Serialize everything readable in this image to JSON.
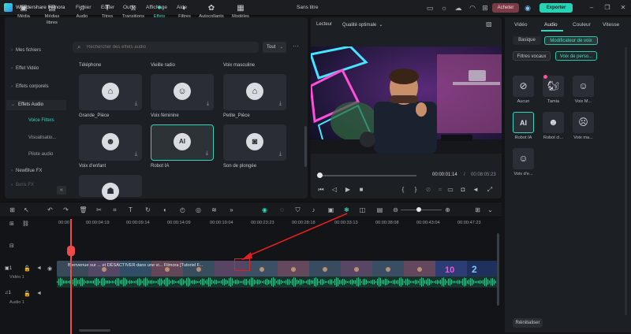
{
  "titlebar": {
    "app_name": "Wondershare Filmora",
    "menu": [
      "Fichier",
      "Editer",
      "Outils",
      "Affichage",
      "Aide"
    ],
    "doc_title": "Sans titre",
    "acheter": "Acheter",
    "exporter": "Exporter"
  },
  "toolbar": {
    "tools": [
      {
        "label": "Média",
        "icon": "media-icon"
      },
      {
        "label": "Médias libres",
        "icon": "stock-media-icon"
      },
      {
        "label": "Audio",
        "icon": "music-icon"
      },
      {
        "label": "Titres",
        "icon": "text-icon"
      },
      {
        "label": "Transitions",
        "icon": "transition-icon"
      },
      {
        "label": "Effets",
        "icon": "effects-icon"
      },
      {
        "label": "Filtres",
        "icon": "filter-icon"
      },
      {
        "label": "Autocollants",
        "icon": "sticker-icon"
      },
      {
        "label": "Modèles",
        "icon": "template-icon"
      }
    ],
    "active": "Effets"
  },
  "sidebar": {
    "items": [
      {
        "label": "Mes fichiers",
        "type": "top"
      },
      {
        "label": "Effet Vidéo",
        "type": "top"
      },
      {
        "label": "Effets corporels",
        "type": "top"
      },
      {
        "label": "Effets Audio",
        "type": "head"
      },
      {
        "label": "Voice Filters",
        "type": "sub-active"
      },
      {
        "label": "Visualisatio...",
        "type": "sub"
      },
      {
        "label": "Pilote audio",
        "type": "sub"
      },
      {
        "label": "NewBlue FX",
        "type": "top"
      },
      {
        "label": "Boris FX",
        "type": "top"
      }
    ]
  },
  "search": {
    "placeholder": "Rechercher des effets audio"
  },
  "filter": {
    "value": "Tout"
  },
  "effects": {
    "rows": [
      {
        "titles": [
          "Téléphone",
          "Vieille radio",
          "Voix masculine"
        ]
      },
      {
        "cards": [
          {
            "glyph": "⌂",
            "name": "Grande_Pièce"
          },
          {
            "glyph": "☺",
            "name": "Voix féminine"
          },
          {
            "glyph": "⌂",
            "name": "Petite_Pièce"
          }
        ]
      },
      {
        "cards": [
          {
            "glyph": "☻",
            "name": "Voix d'enfant"
          },
          {
            "glyph": "AI",
            "name": "Robot IA"
          },
          {
            "glyph": "◙",
            "name": "Son de plongée"
          }
        ]
      }
    ],
    "selected": "Robot IA"
  },
  "player": {
    "label": "Lecteur",
    "quality": "Qualité optimale",
    "current_time": "00:00:01:14",
    "separator": "/",
    "total_time": "00:08:05:23"
  },
  "right_panel": {
    "tabs": [
      "Vidéo",
      "Audio",
      "Couleur",
      "Vitesse"
    ],
    "active_tab": "Audio",
    "subtabs": [
      "Basique",
      "Modificateur de voix"
    ],
    "active_subtab": "Modificateur de voix",
    "chips": [
      "Filtres vocaux",
      "Voix de perso..."
    ],
    "active_chip": "Voix de perso...",
    "voices": [
      {
        "name": "Aucun",
        "glyph": "⊘"
      },
      {
        "name": "Tamia",
        "glyph": "🐿"
      },
      {
        "name": "Voix M...",
        "glyph": "☺"
      },
      {
        "name": "Robot IA",
        "glyph": "AI"
      },
      {
        "name": "Robot cl...",
        "glyph": "☻"
      },
      {
        "name": "Voix ma...",
        "glyph": "☹"
      },
      {
        "name": "Voix d'e...",
        "glyph": "☺"
      }
    ],
    "selected_voice": "Robot IA",
    "reset": "Réinitialiser"
  },
  "timeline": {
    "ruler": [
      "00:00",
      "00:00:04:19",
      "00:00:09:14",
      "00:00:14:09",
      "00:00:19:04",
      "00:00:23:23",
      "00:00:28:18",
      "00:00:33:13",
      "00:00:38:08",
      "00:00:43:04",
      "00:00:47:23"
    ],
    "video_track": {
      "index": "1",
      "name": "Vidéo 1"
    },
    "audio_track": {
      "index": "1",
      "name": "Audio 1"
    },
    "clip_label": "Bienvenue sur ... et DÉSACTIVER dans une vi... Filmora [Tutoriel F..."
  }
}
